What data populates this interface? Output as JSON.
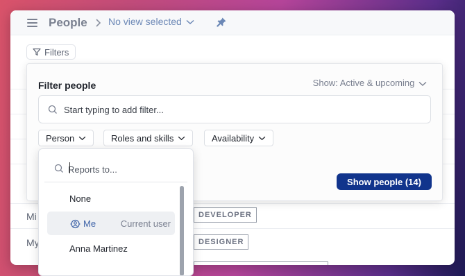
{
  "header": {
    "title": "People",
    "view_select": "No view selected"
  },
  "toolbar": {
    "filters_label": "Filters"
  },
  "background_rows": [
    {
      "name": "Mi",
      "role": "DEVELOPER"
    },
    {
      "name": "My",
      "role": "DESIGNER"
    }
  ],
  "filter_panel": {
    "title": "Filter people",
    "show_select": "Show: Active & upcoming",
    "search_placeholder": "Start typing to add filter...",
    "chips": [
      "Person",
      "Roles and skills",
      "Availability"
    ],
    "show_button": "Show people (14)"
  },
  "person_dropdown": {
    "search_placeholder": "Reports to...",
    "items": [
      {
        "label": "None"
      },
      {
        "label": "Me",
        "tag": "Current user",
        "highlighted": true
      },
      {
        "label": "Anna Martinez"
      }
    ]
  },
  "colors": {
    "primary": "#11348c",
    "link": "#3e63a8"
  }
}
